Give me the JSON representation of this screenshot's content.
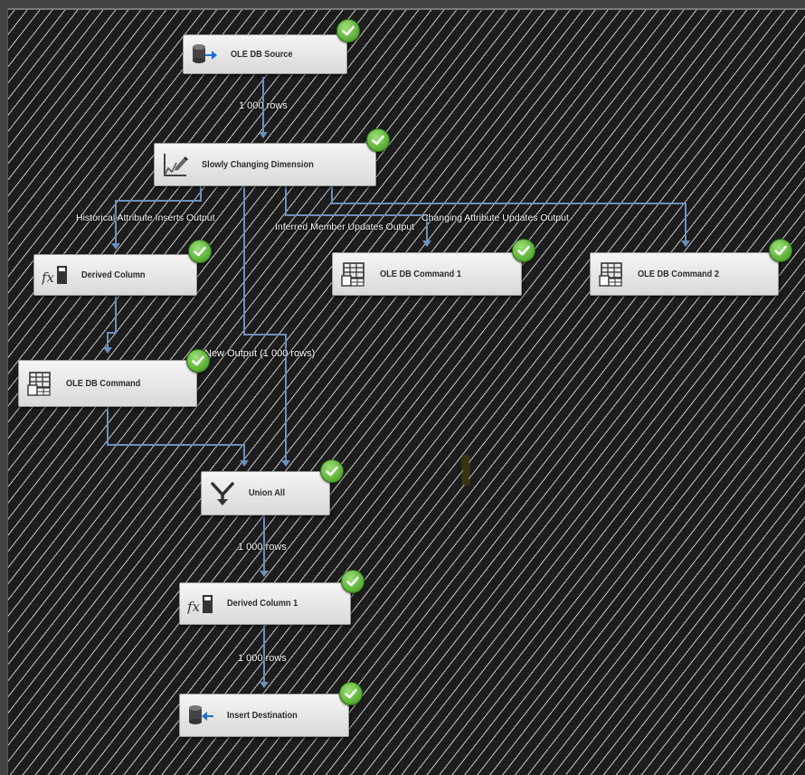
{
  "nodes": {
    "ole_db_source": "OLE DB Source",
    "scd": "Slowly Changing Dimension",
    "derived_column": "Derived Column",
    "ole_db_command_1": "OLE DB Command 1",
    "ole_db_command_2": "OLE DB Command 2",
    "ole_db_command": "OLE DB Command",
    "union_all": "Union All",
    "derived_column_1": "Derived Column 1",
    "insert_destination": "Insert Destination"
  },
  "edge_labels": {
    "source_rows": "1 000 rows",
    "historical": "Historical Attribute Inserts Output",
    "inferred": "Inferred Member Updates Output",
    "changing": "Changing Attribute Updates Output",
    "new_output": "New Output (1 000 rows)",
    "union_rows": "1 000 rows",
    "derived_rows": "1 000 rows"
  },
  "icons": {
    "source": "database-arrow-right-icon",
    "scd": "chart-edit-icon",
    "derived": "fx-icon",
    "command": "table-grid-icon",
    "union": "union-merge-icon",
    "destination": "database-arrow-left-icon",
    "status": "green-check-icon"
  },
  "colors": {
    "canvas": "#1d1d1d",
    "hatch": "#c8c8c8",
    "edge": "#6d8fbf",
    "check": "#5fb33a"
  }
}
